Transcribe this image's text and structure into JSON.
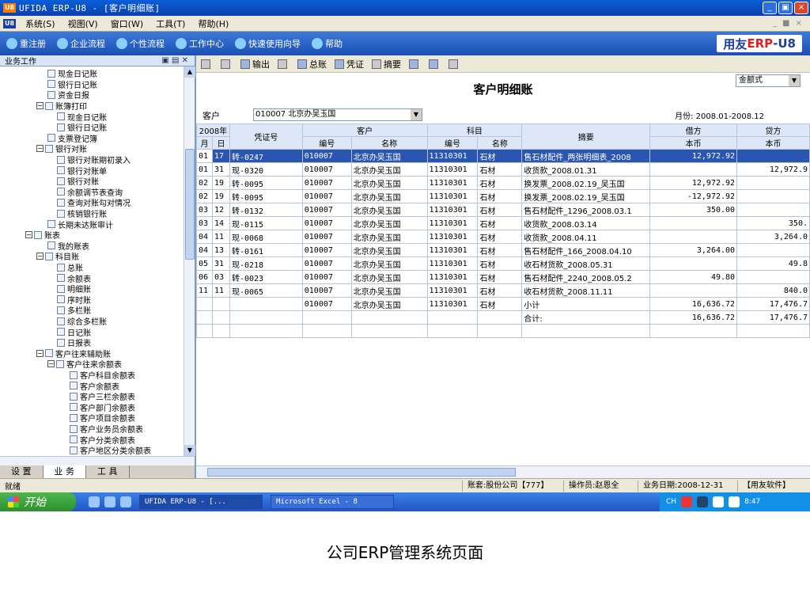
{
  "window": {
    "title": "UFIDA ERP-U8 - [客户明细账]",
    "buttons": [
      "_",
      "▣",
      "×"
    ]
  },
  "menu": {
    "items": [
      "系统(S)",
      "视图(V)",
      "窗口(W)",
      "工具(T)",
      "帮助(H)"
    ],
    "right": "_ ■ ×"
  },
  "quickbar": {
    "items": [
      "重注册",
      "企业流程",
      "个性流程",
      "工作中心",
      "快速使用向导",
      "帮助"
    ],
    "brand_prefix": "用友",
    "brand_red": "ERP",
    "brand_suffix": "-U8"
  },
  "leftpanel": {
    "header": "业务工作",
    "tree": [
      {
        "label": "现金日记账",
        "type": "doc"
      },
      {
        "label": "银行日记账",
        "type": "doc"
      },
      {
        "label": "资金日报",
        "type": "doc"
      },
      {
        "label": "账簿打印",
        "type": "folder"
      },
      {
        "label": "现金日记账",
        "type": "doc"
      },
      {
        "label": "银行日记账",
        "type": "doc"
      },
      {
        "label": "支票登记簿",
        "type": "doc"
      },
      {
        "label": "银行对账",
        "type": "folder"
      },
      {
        "label": "银行对账期初录入",
        "type": "doc"
      },
      {
        "label": "银行对账单",
        "type": "doc"
      },
      {
        "label": "银行对账",
        "type": "doc"
      },
      {
        "label": "余额调节表查询",
        "type": "doc"
      },
      {
        "label": "查询对账勾对情况",
        "type": "doc"
      },
      {
        "label": "核销银行账",
        "type": "doc"
      },
      {
        "label": "长期未达账审计",
        "type": "doc"
      },
      {
        "label": "账表",
        "type": "folder"
      },
      {
        "label": "我的账表",
        "type": "doc"
      },
      {
        "label": "科目账",
        "type": "folder"
      },
      {
        "label": "总账",
        "type": "doc"
      },
      {
        "label": "余额表",
        "type": "doc"
      },
      {
        "label": "明细账",
        "type": "doc"
      },
      {
        "label": "序时账",
        "type": "doc"
      },
      {
        "label": "多栏账",
        "type": "doc"
      },
      {
        "label": "综合多栏账",
        "type": "doc"
      },
      {
        "label": "日记账",
        "type": "doc"
      },
      {
        "label": "日报表",
        "type": "doc"
      },
      {
        "label": "客户往来辅助账",
        "type": "folder"
      },
      {
        "label": "客户往来余额表",
        "type": "folder"
      },
      {
        "label": "客户科目余额表",
        "type": "doc"
      },
      {
        "label": "客户余额表",
        "type": "doc"
      },
      {
        "label": "客户三栏余额表",
        "type": "doc"
      },
      {
        "label": "客户部门余额表",
        "type": "doc"
      },
      {
        "label": "客户项目余额表",
        "type": "doc"
      },
      {
        "label": "客户业务员余额表",
        "type": "doc"
      },
      {
        "label": "客户分类余额表",
        "type": "doc"
      },
      {
        "label": "客户地区分类余额表",
        "type": "doc"
      }
    ],
    "tabs": [
      "设 置",
      "业 务",
      "工 具"
    ]
  },
  "toolbar": {
    "items": [
      "",
      "",
      "输出",
      "",
      "",
      "总账",
      "",
      "凭证",
      "",
      "摘要",
      "",
      "",
      ""
    ]
  },
  "report": {
    "title": "客户明细账",
    "format_select": "金额式",
    "customer_label": "客户",
    "customer_value": "010007  北京办吴玉国",
    "month_label": "月份: 2008.01-2008.12",
    "headers": {
      "year": "2008年",
      "month": "月",
      "day": "日",
      "voucher": "凭证号",
      "customer": "客户",
      "cust_code": "编号",
      "cust_name": "名称",
      "subject": "科目",
      "subj_code": "编号",
      "subj_name": "名称",
      "summary": "摘要",
      "debit": "借方",
      "debit_cur": "本币",
      "credit": "贷方",
      "credit_cur": "本币"
    },
    "rows": [
      {
        "m": "01",
        "d": "17",
        "v": "转-0247",
        "cc": "010007",
        "cn": "北京办吴玉国",
        "sc": "11310301",
        "sn": "石材",
        "sum": "售石材配件_两张明细表_2008",
        "dr": "12,972.92",
        "cr": "",
        "sel": true
      },
      {
        "m": "01",
        "d": "31",
        "v": "现-0320",
        "cc": "010007",
        "cn": "北京办吴玉国",
        "sc": "11310301",
        "sn": "石材",
        "sum": "收货款_2008.01.31",
        "dr": "",
        "cr": "12,972.9"
      },
      {
        "m": "02",
        "d": "19",
        "v": "转-0095",
        "cc": "010007",
        "cn": "北京办吴玉国",
        "sc": "11310301",
        "sn": "石材",
        "sum": "换发票_2008.02.19_吴玉国",
        "dr": "12,972.92",
        "cr": ""
      },
      {
        "m": "02",
        "d": "19",
        "v": "转-0095",
        "cc": "010007",
        "cn": "北京办吴玉国",
        "sc": "11310301",
        "sn": "石材",
        "sum": "换发票_2008.02.19_吴玉国",
        "dr": "-12,972.92",
        "cr": ""
      },
      {
        "m": "03",
        "d": "12",
        "v": "转-0132",
        "cc": "010007",
        "cn": "北京办吴玉国",
        "sc": "11310301",
        "sn": "石材",
        "sum": "售石材配件_1296_2008.03.1",
        "dr": "350.00",
        "cr": ""
      },
      {
        "m": "03",
        "d": "14",
        "v": "现-0115",
        "cc": "010007",
        "cn": "北京办吴玉国",
        "sc": "11310301",
        "sn": "石材",
        "sum": "收货款_2008.03.14",
        "dr": "",
        "cr": "350."
      },
      {
        "m": "04",
        "d": "11",
        "v": "现-0068",
        "cc": "010007",
        "cn": "北京办吴玉国",
        "sc": "11310301",
        "sn": "石材",
        "sum": "收货款_2008.04.11",
        "dr": "",
        "cr": "3,264.0"
      },
      {
        "m": "04",
        "d": "13",
        "v": "转-0161",
        "cc": "010007",
        "cn": "北京办吴玉国",
        "sc": "11310301",
        "sn": "石材",
        "sum": "售石材配件_166_2008.04.10",
        "dr": "3,264.00",
        "cr": ""
      },
      {
        "m": "05",
        "d": "31",
        "v": "现-0218",
        "cc": "010007",
        "cn": "北京办吴玉国",
        "sc": "11310301",
        "sn": "石材",
        "sum": "收石材货款_2008.05.31",
        "dr": "",
        "cr": "49.8"
      },
      {
        "m": "06",
        "d": "03",
        "v": "转-0023",
        "cc": "010007",
        "cn": "北京办吴玉国",
        "sc": "11310301",
        "sn": "石材",
        "sum": "售石材配件_2240_2008.05.2",
        "dr": "49.80",
        "cr": ""
      },
      {
        "m": "11",
        "d": "11",
        "v": "现-0065",
        "cc": "010007",
        "cn": "北京办吴玉国",
        "sc": "11310301",
        "sn": "石材",
        "sum": "收石材货款_2008.11.11",
        "dr": "",
        "cr": "840.0"
      },
      {
        "m": "",
        "d": "",
        "v": "",
        "cc": "010007",
        "cn": "北京办吴玉国",
        "sc": "11310301",
        "sn": "石材",
        "sum": "小计",
        "dr": "16,636.72",
        "cr": "17,476.7"
      },
      {
        "m": "",
        "d": "",
        "v": "",
        "cc": "",
        "cn": "",
        "sc": "",
        "sn": "",
        "sum": "合计:",
        "dr": "16,636.72",
        "cr": "17,476.7"
      }
    ]
  },
  "statusbar": {
    "left": "就绪",
    "account": "账套:股份公司【777】",
    "operator": "操作员:赵恩全",
    "date": "业务日期:2008-12-31",
    "vendor": "【用友软件】"
  },
  "taskbar": {
    "start": "开始",
    "items": [
      "UFIDA ERP-U8 - [...",
      "Microsoft Excel - 8"
    ],
    "tray_lang": "CH",
    "clock": "8:47"
  },
  "caption": "公司ERP管理系统页面"
}
